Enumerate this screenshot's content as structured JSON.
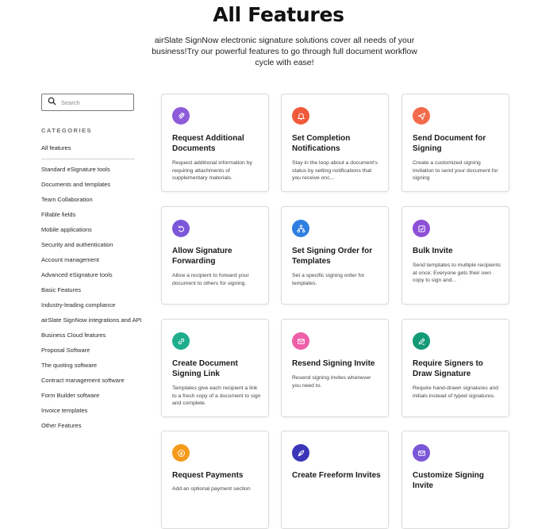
{
  "page": {
    "title": "All Features",
    "subtitle": "airSlate SignNow electronic signature solutions cover all needs of your business!Try our powerful features to go through full document workflow cycle with ease!"
  },
  "sidebar": {
    "search_placeholder": "Search",
    "categories_heading": "CATEGORIES",
    "all_label": "All features",
    "items": [
      "Standard eSignature tools",
      "Documents and templates",
      "Team Collaboration",
      "Fillable fields",
      "Mobile applications",
      "Security and authentication",
      "Account management",
      "Advanced eSignature tools",
      "Basic Features",
      "Industry-leading compliance",
      "airSlate SignNow integrations and API",
      "Business Cloud features",
      "Proposal Software",
      "The quoting software",
      "Contract management software",
      "Form Builder software",
      "Invoice templates",
      "Other Features"
    ]
  },
  "cards": [
    {
      "title": "Request Additional Documents",
      "desc": "Request additional information by requiring attachments of supplementary materials.",
      "icon": "paperclip-icon",
      "color": "#8e5bd9"
    },
    {
      "title": "Set Completion Notifications",
      "desc": "Stay in the loop about a document's status by setting notifications that you receive onc...",
      "icon": "bell-icon",
      "color": "#f05a3a"
    },
    {
      "title": "Send Document for Signing",
      "desc": "Create a customized signing invitation to send your document for signing",
      "icon": "send-icon",
      "color": "#f26b4b"
    },
    {
      "title": "Allow Signature Forwarding",
      "desc": "Allow a recipient to forward your document to others for signing.",
      "icon": "forward-icon",
      "color": "#7b57d9"
    },
    {
      "title": "Set Signing Order for Templates",
      "desc": "Set a specific signing order for templates.",
      "icon": "hierarchy-icon",
      "color": "#2f7fe0"
    },
    {
      "title": "Bulk Invite",
      "desc": "Send templates to multiple recipients at once; Everyone gets their own copy to sign and...",
      "icon": "bulk-invite-icon",
      "color": "#8d4fd6"
    },
    {
      "title": "Create Document Signing Link",
      "desc": "Templates give each recipient a link to a fresh copy of a document to sign and complete.",
      "icon": "link-icon",
      "color": "#1fae8c"
    },
    {
      "title": "Resend Signing Invite",
      "desc": "Resend signing invites whenever you need to.",
      "icon": "envelope-icon",
      "color": "#ee5fa8"
    },
    {
      "title": "Require Signers to Draw Signature",
      "desc": "Require hand-drawn signatures and initials instead of typed signatures.",
      "icon": "pen-icon",
      "color": "#139a78"
    },
    {
      "title": "Request Payments",
      "desc": "Add an optional payment section",
      "icon": "dollar-icon",
      "color": "#f59a1b"
    },
    {
      "title": "Create Freeform Invites",
      "desc": "",
      "icon": "feather-icon",
      "color": "#3b35b8"
    },
    {
      "title": "Customize Signing Invite",
      "desc": "",
      "icon": "envelope-edit-icon",
      "color": "#7b57d9"
    }
  ]
}
